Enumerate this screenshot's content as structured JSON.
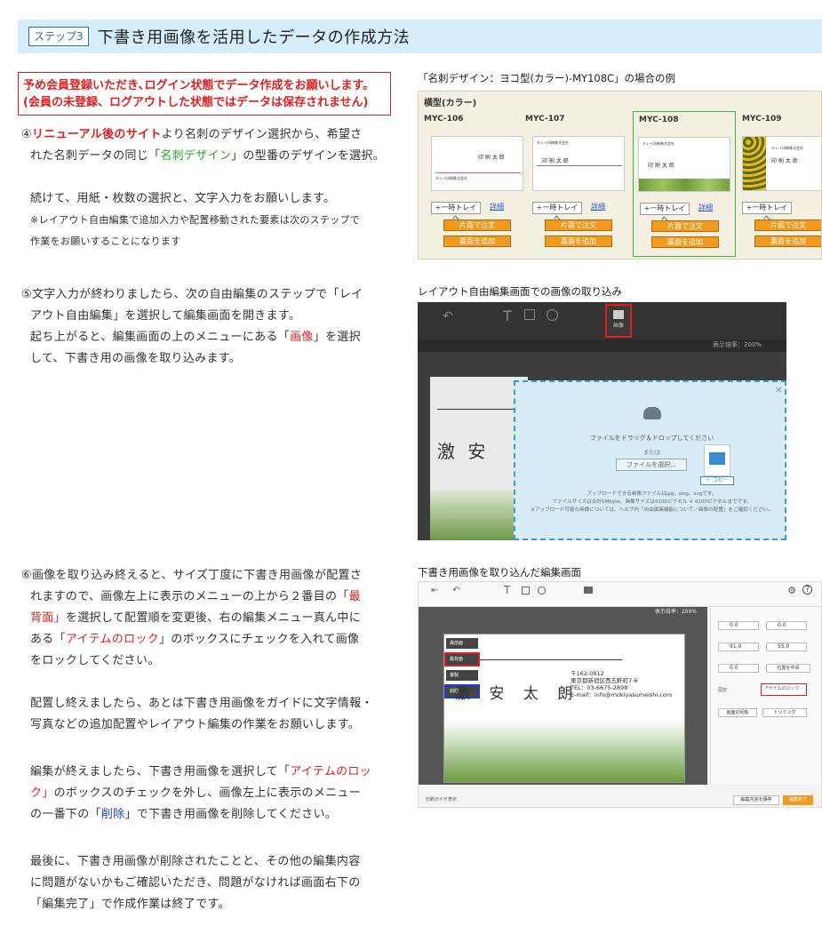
{
  "header": {
    "step_label": "ステップ3",
    "title": "下書き用画像を活用したデータの作成方法"
  },
  "notice": {
    "line1": "予め会員登録いただき､ログイン状態でデータ作成をお願いします。",
    "line2": "(会員の未登録、ログアウトした状態ではデータは保存されません)"
  },
  "step4": {
    "l1_a": "④",
    "l1_b": "リニューアル後のサイト",
    "l1_c": "より名刺のデザイン選択から、希望さ",
    "l2_a": "れた名刺データの同じ「",
    "l2_b": "名刺デザイン",
    "l2_c": "」の型番のデザインを選択。",
    "l3": "続けて、用紙・枚数の選択と、文字入力をお願いします。",
    "l4": "※レイアウト自由編集で追加入力や配置移動された要素は次のステップで",
    "l5": "作業をお願いすることになります"
  },
  "step5": {
    "l1": "⑤文字入力が終わりましたら、次の自由編集のステップで「レイ",
    "l2": "アウト自由編集」を選択して編集画面を開きます。",
    "l3_a": "起ち上がると、編集画面の上のメニューにある「",
    "l3_b": "画像",
    "l3_c": "」を選択",
    "l4": "して、下書き用の画像を取り込みます。"
  },
  "step6": {
    "l1_a": "⑥画像を取り込み終えると、サイズ丁度に下書き用画像が配置さ",
    "l1_b": "れますので、画像左上に表示のメニューの上から２番目の「",
    "l1_c": "最",
    "l2_a": "背面」",
    "l2_b": "を選択して配置順を変更後、右の編集メニュー真ん中に",
    "l3_a": "ある「",
    "l3_b": "アイテムのロック",
    "l3_c": "」のボックスにチェックを入れて画像",
    "l4": "をロックしてください。",
    "p2_l1": "配置し終えましたら、あとは下書き用画像をガイドに文字情報・",
    "p2_l2": "写真などの追加配置やレイアウト編集の作業をお願いします。",
    "p3_l1_a": "編集が終えましたら、下書き用画像を選択して「",
    "p3_l1_b": "アイテムのロッ",
    "p3_l2_a": "ク」",
    "p3_l2_b": "のボックスのチェックを外し、画像左上に表示のメニュー",
    "p3_l3_a": "の一番下の「",
    "p3_l3_b": "削除",
    "p3_l3_c": "」で下書き用画像を削除してください。",
    "p4_l1": "最後に、下書き用画像が削除されたことと、その他の編集内容",
    "p4_l2": "に問題がないかもご確認いただき、問題がなければ画面右下の",
    "p4_l3": "「編集完了」で作成作業は終了です。"
  },
  "captions": {
    "c1": "「名刺デザイン：ヨコ型(カラー)-MY108C」の場合の例",
    "c2": "レイアウト自由編集画面での画像の取り込み",
    "c3": "下書き用画像を取り込んだ編集画面"
  },
  "sample1": {
    "category": "横型(カラー)",
    "cards": [
      {
        "code": "MYC-106",
        "btn": "+一時トレイへ",
        "detail": "詳細",
        "front": "片面で注文",
        "back": "裏面を追加"
      },
      {
        "code": "MYC-107",
        "btn": "+一時トレイへ",
        "detail": "詳細",
        "front": "片面で注文",
        "back": "裏面を追加"
      },
      {
        "code": "MYC-108",
        "btn": "+一時トレイへ",
        "detail": "詳細",
        "front": "片面で注文",
        "back": "裏面を追加"
      },
      {
        "code": "MYC-109",
        "btn": "+一時トレイへ",
        "detail": "",
        "front": "片面で注文",
        "back": "裏面を追加"
      }
    ],
    "name1": "印 刷 太 郎",
    "company": "キレイ印刷株式会社"
  },
  "sample2": {
    "toolbar_image": "画像",
    "zoom": "表示倍率：200%",
    "drop_text": "ファイルをドラッグ＆ドロップしてください",
    "or_text": "または",
    "select_btn": "ファイルを選択...",
    "copy": "＋ コピー",
    "info1": "アップロードできる画像ファイルはjpg、png、svgです。",
    "info2": "ファイルサイズは合計5Mbyte、画像サイズは4100ピクセル × 4100ピクセルまでです。",
    "info3": "※アップロード可能な画像については、ヘルプ内「自由編集機能について／画像の配置」をご確認ください。",
    "canvas_text": "激 安",
    "close": "×"
  },
  "sample3": {
    "zoom": "表示倍率：200%",
    "menu": [
      "最前面",
      "最背面",
      "複製",
      "削除"
    ],
    "zip": "〒162-0812",
    "address": "東京都新宿区西五軒町7-6",
    "tel": "TEL：03-6675-2898",
    "email": "E-mail：info@mokiyasumeishi.com",
    "name": "激 安 太 朗",
    "lock": "アイテムのロック",
    "fix": "固定",
    "back_btn": "画面の反転",
    "trim": "トリミング",
    "align": "位置を中央",
    "guide": "印刷ガイド表示",
    "save": "編集内容を保存",
    "done": "編集完了",
    "fields": [
      "0.0",
      "0.0",
      "91.0",
      "55.0",
      "0.0"
    ],
    "settings": "設定",
    "help": "ヘルプ"
  },
  "colors": {
    "header_bg": "#d6eefb",
    "accent_red": "#e02020",
    "accent_green": "#22aa22",
    "accent_blue": "#1a3fd0",
    "orange": "#f19a20"
  }
}
